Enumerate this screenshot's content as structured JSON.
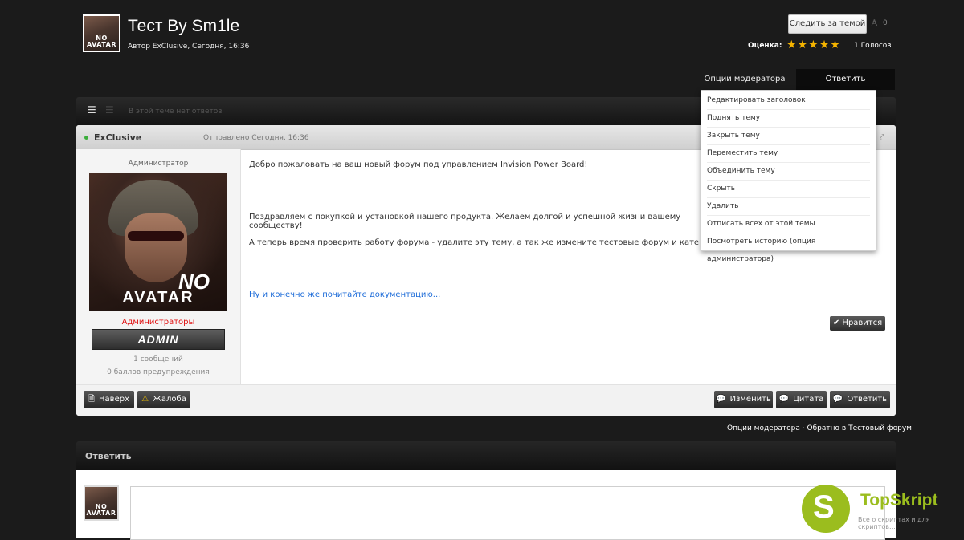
{
  "topic": {
    "title": "Тест By Sm1le",
    "meta": "Автор ExClusive, Сегодня, 16:36",
    "avatar_text": "NO AVATAR",
    "follow_label": "Следить за темой",
    "followers_count": "0",
    "rating_label": "Оценка:",
    "rating_stars": 5,
    "votes": "1 Голосов"
  },
  "tabs": {
    "moderator_options": "Опции модератора",
    "reply": "Ответить"
  },
  "toolbar": {
    "no_replies": "В этой теме нет ответов"
  },
  "post": {
    "author": "ExClusive",
    "posted": "Отправлено Сегодня, 16:36",
    "author_role": "Администратор",
    "avatar_no": "NO",
    "avatar_word": "AVATAR",
    "group": "Администраторы",
    "badge": "ADMIN",
    "post_count": "1 сообщений",
    "warn_points": "0 баллов предупреждения",
    "paragraphs": [
      "Добро пожаловать на ваш новый форум под управлением Invision Power Board!",
      "Поздравляем с покупкой и установкой нашего продукта. Желаем долгой и успешной жизни вашему сообществу!",
      "А теперь время проверить работу форума - удалите эту тему, а так же измените тестовые форум и категорию в а"
    ],
    "link": "Ну и конечно же почитайте документацию...",
    "like_label": "Нравится",
    "footer": {
      "top": "Наверх",
      "report": "Жалоба",
      "edit": "Изменить",
      "quote": "Цитата",
      "reply": "Ответить"
    }
  },
  "bottom_links": {
    "mod_options": "Опции модератора",
    "separator": "·",
    "back": "Обратно в Тестовый форум"
  },
  "reply_box": {
    "title": "Ответить"
  },
  "moderator_menu": [
    "Редактировать заголовок",
    "Поднять тему",
    "Закрыть тему",
    "Переместить тему",
    "Объединить тему",
    "Скрыть",
    "Удалить",
    "Отписать всех от этой темы",
    "Посмотреть историю (опция администратора)"
  ],
  "watermark": {
    "letter": "S",
    "name": "TopSkript",
    "tagline": "Все о скриптах и для скриптов..."
  },
  "colors": {
    "background": "#1b1b1b",
    "star": "#f5b400",
    "group_red": "#e01010",
    "link": "#1c6bd8",
    "online": "#3cae3c",
    "watermark_green": "#9bbd1e"
  }
}
